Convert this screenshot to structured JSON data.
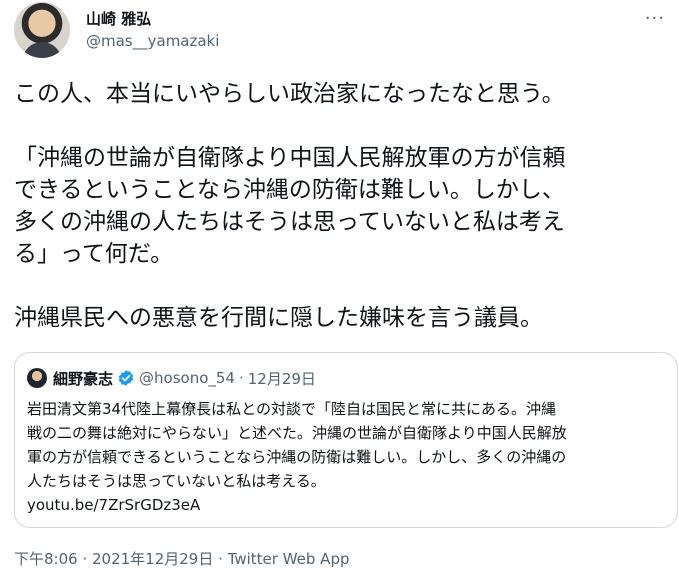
{
  "tweet": {
    "author": {
      "name": "山崎 雅弘",
      "handle": "@mas__yamazaki",
      "avatar_icon": "user-avatar-photo"
    },
    "more_icon": "more-options-icon",
    "more_glyph": "···",
    "body_lines": [
      "この人、本当にいやらしい政治家になったなと思う。",
      "",
      "「沖縄の世論が自衛隊より中国人民解放軍の方が信頼",
      "できるということなら沖縄の防衛は難しい。しかし、",
      "多くの沖縄の人たちはそうは思っていないと私は考え",
      "る」って何だ。",
      "",
      "沖縄県民への悪意を行間に隠した嫌味を言う議員。"
    ],
    "quote": {
      "author_name": "細野豪志",
      "verified_icon": "verified-badge-icon",
      "handle": "@hosono_54",
      "separator": "·",
      "date": "12月29日",
      "text_lines": [
        "岩田清文第34代陸上幕僚長は私との対談で「陸自は国民と常に共にある。沖縄",
        "戦の二の舞は絶対にやらない」と述べた。沖縄の世論が自衛隊より中国人民解放",
        "軍の方が信頼できるということなら沖縄の防衛は難しい。しかし、多くの沖縄の",
        "人たちはそうは思っていないと私は考える。",
        "youtu.be/7ZrSrGDz3eA"
      ]
    },
    "meta": {
      "time": "下午8:06",
      "separator": " · ",
      "date": "2021年12月29日",
      "app": "Twitter Web App"
    },
    "colors": {
      "text": "#0f1419",
      "secondary": "#536471",
      "border": "#cfd9de",
      "verified": "#1d9bf0"
    }
  }
}
